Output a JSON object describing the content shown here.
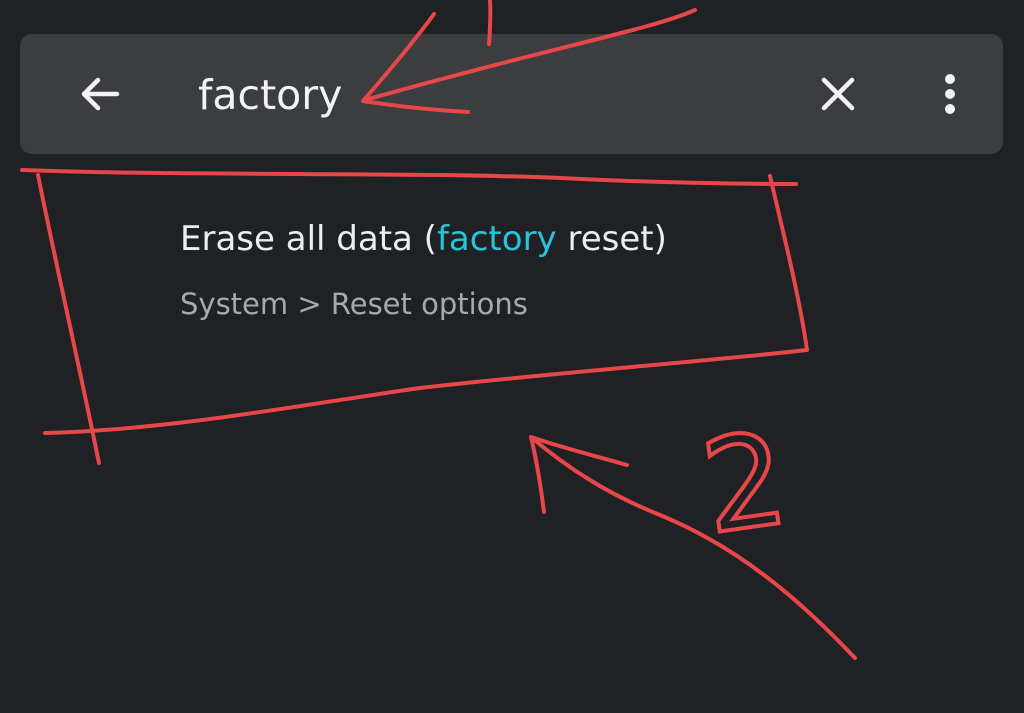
{
  "search": {
    "query": "factory",
    "icons": {
      "back": "arrow-back-icon",
      "clear": "close-icon",
      "more": "more-vert-icon"
    }
  },
  "results": [
    {
      "title_prefix": "Erase all data (",
      "title_highlight": "factory",
      "title_suffix": " reset)",
      "path": "System > Reset options"
    }
  ],
  "annotations": {
    "step_2_label": "2",
    "color": "#e8474a"
  },
  "colors": {
    "background": "#202124",
    "search_bar": "#3c3d3f",
    "highlight": "#26c6da"
  }
}
